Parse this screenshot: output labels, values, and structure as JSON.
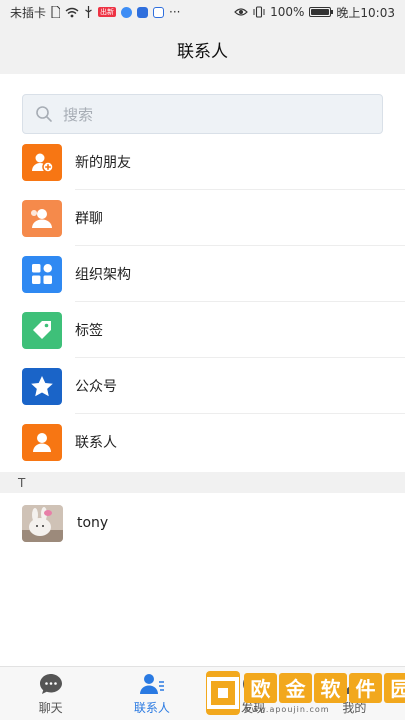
{
  "status_bar": {
    "carrier": "未插卡",
    "sim_icon": "sim-card-icon",
    "wifi_icon": "wifi-icon",
    "usb_icon": "usb-icon",
    "badge_text": "出新",
    "eye_icon": "eye-comfort-icon",
    "vibrate_icon": "vibrate-icon",
    "battery_text": "100%",
    "time": "晚上10:03",
    "more": "···"
  },
  "header": {
    "title": "联系人"
  },
  "search": {
    "placeholder": "搜索",
    "icon": "search-icon"
  },
  "menu": [
    {
      "label": "新的朋友",
      "icon": "add-friend-icon",
      "color": "#f77613"
    },
    {
      "label": "群聊",
      "icon": "group-chat-icon",
      "color": "#f58a4b"
    },
    {
      "label": "组织架构",
      "icon": "org-structure-icon",
      "color": "#2f89f2"
    },
    {
      "label": "标签",
      "icon": "tag-icon",
      "color": "#3ec079"
    },
    {
      "label": "公众号",
      "icon": "star-icon",
      "color": "#1a64c8"
    },
    {
      "label": "联系人",
      "icon": "contact-person-icon",
      "color": "#f77613"
    }
  ],
  "section": {
    "letter": "T"
  },
  "contacts": [
    {
      "name": "tony"
    }
  ],
  "tabs": [
    {
      "label": "聊天",
      "icon": "chat-bubble-icon",
      "active": false
    },
    {
      "label": "联系人",
      "icon": "contacts-icon",
      "active": true
    },
    {
      "label": "发现",
      "icon": "discover-icon",
      "active": false
    },
    {
      "label": "我的",
      "icon": "profile-icon",
      "active": false
    }
  ],
  "watermark": {
    "title_chars": [
      "欧",
      "金",
      "软",
      "件",
      "园"
    ],
    "url": "www.apoujin.com"
  },
  "colors": {
    "accent": "#2a7ae2",
    "header_bg": "#f1f1f1"
  }
}
